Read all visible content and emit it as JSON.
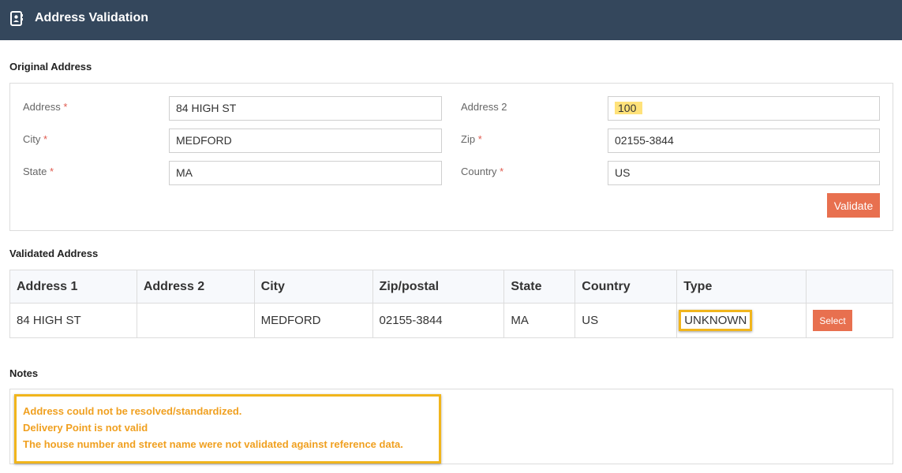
{
  "header": {
    "title": "Address Validation",
    "icon": "contact-book-icon"
  },
  "original": {
    "section_title": "Original Address",
    "fields": {
      "address": {
        "label": "Address",
        "required": "*",
        "value": "84 HIGH ST"
      },
      "address2": {
        "label": "Address 2",
        "required": "",
        "value": "100"
      },
      "city": {
        "label": "City",
        "required": "*",
        "value": "MEDFORD"
      },
      "zip": {
        "label": "Zip",
        "required": "*",
        "value": "02155-3844"
      },
      "state": {
        "label": "State",
        "required": "*",
        "value": "MA"
      },
      "country": {
        "label": "Country",
        "required": "*",
        "value": "US"
      }
    },
    "validate_label": "Validate"
  },
  "validated": {
    "section_title": "Validated Address",
    "columns": [
      "Address 1",
      "Address 2",
      "City",
      "Zip/postal",
      "State",
      "Country",
      "Type",
      ""
    ],
    "row": {
      "address1": "84 HIGH ST",
      "address2": "",
      "city": "MEDFORD",
      "zip": "02155-3844",
      "state": "MA",
      "country": "US",
      "type": "UNKNOWN"
    },
    "select_label": "Select"
  },
  "notes": {
    "section_title": "Notes",
    "items": [
      "Address could not be resolved/standardized.",
      "Delivery Point is not valid",
      "The house number and street name were not validated against reference data."
    ]
  },
  "colors": {
    "header_bg": "#34475c",
    "accent": "#e8704f",
    "highlight": "#f1b51c",
    "note_text": "#f0a020"
  }
}
